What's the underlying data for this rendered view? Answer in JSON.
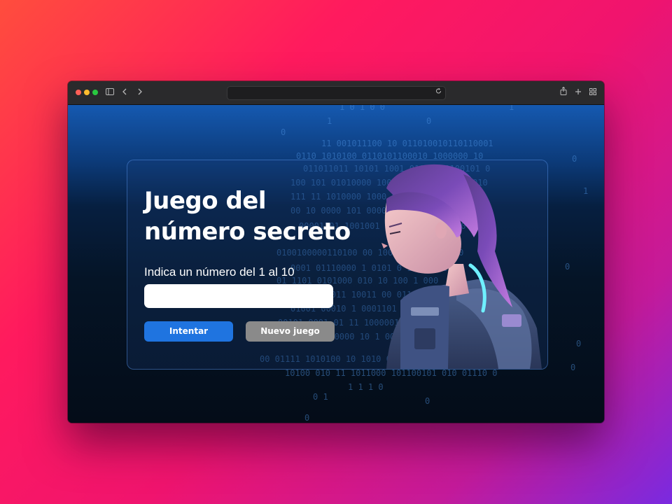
{
  "browser": {
    "address_value": "",
    "icons": [
      "sidebar-icon",
      "back-icon",
      "forward-icon",
      "reload-icon",
      "share-icon",
      "new-tab-icon",
      "tabs-overview-icon"
    ]
  },
  "page": {
    "title_line1": "Juego del",
    "title_line2": "número secreto",
    "prompt": "Indica un número del 1 al 10",
    "input_value": "",
    "buttons": {
      "try": "Intentar",
      "new_game": "Nuevo juego"
    }
  },
  "colors": {
    "primary_button": "#1f74e0",
    "secondary_button": "#8a8a8a",
    "background_gradient": [
      "#ff4d3d",
      "#f0146e",
      "#7a2ae0"
    ]
  }
}
